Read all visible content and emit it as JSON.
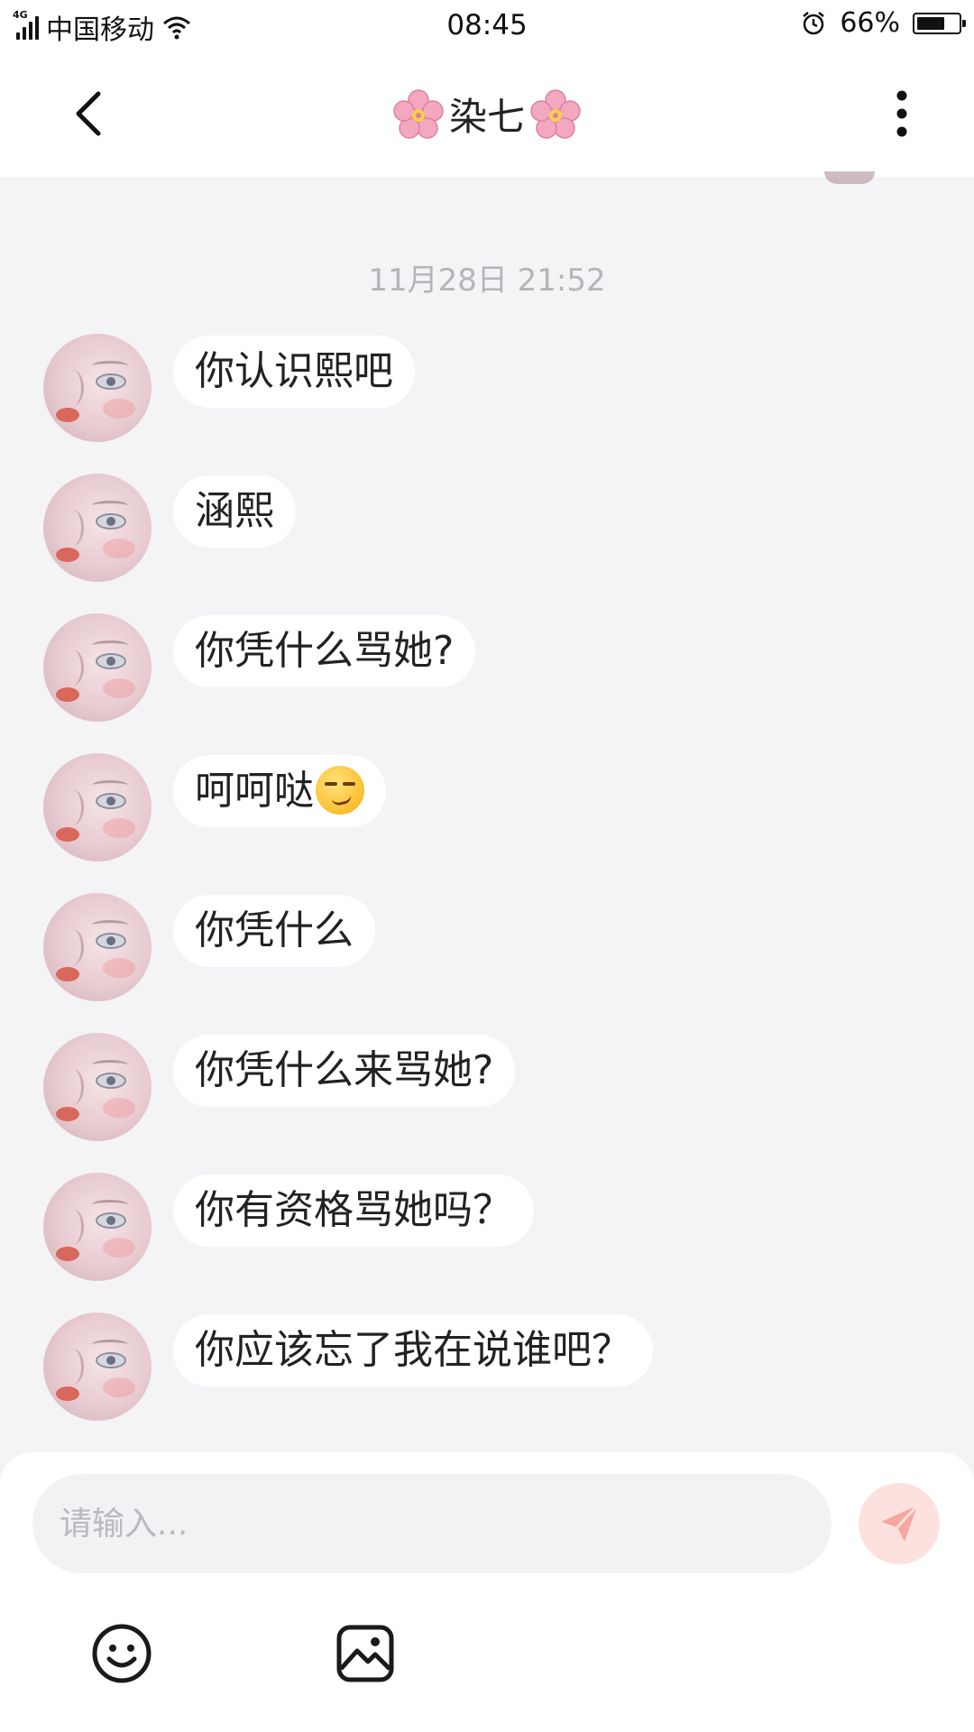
{
  "status_bar": {
    "network": "4G",
    "carrier": "中国移动",
    "time": "08:45",
    "battery": "66%",
    "battery_level": 0.66
  },
  "header": {
    "title": "染七",
    "title_decoration": "🌸",
    "back_icon": "chevron-left-icon",
    "more_icon": "vertical-ellipsis-icon"
  },
  "chat": {
    "timestamp": "11月28日 21:52",
    "messages": [
      {
        "text": "你认识熙吧"
      },
      {
        "text": "涵熙"
      },
      {
        "text": "你凭什么骂她?"
      },
      {
        "text": "呵呵哒",
        "emoji": "smirk-emoji"
      },
      {
        "text": "你凭什么"
      },
      {
        "text": "你凭什么来骂她?"
      },
      {
        "text": "你有资格骂她吗？"
      },
      {
        "text": "你应该忘了我在说谁吧？"
      }
    ]
  },
  "composer": {
    "placeholder": "请输入...",
    "send_icon": "paper-plane-icon",
    "tools": [
      "smiley-icon",
      "image-icon"
    ]
  },
  "colors": {
    "background": "#f4f4f6",
    "bubble": "#ffffff",
    "send_button": "#fde1de",
    "send_icon": "#f6a79f"
  }
}
